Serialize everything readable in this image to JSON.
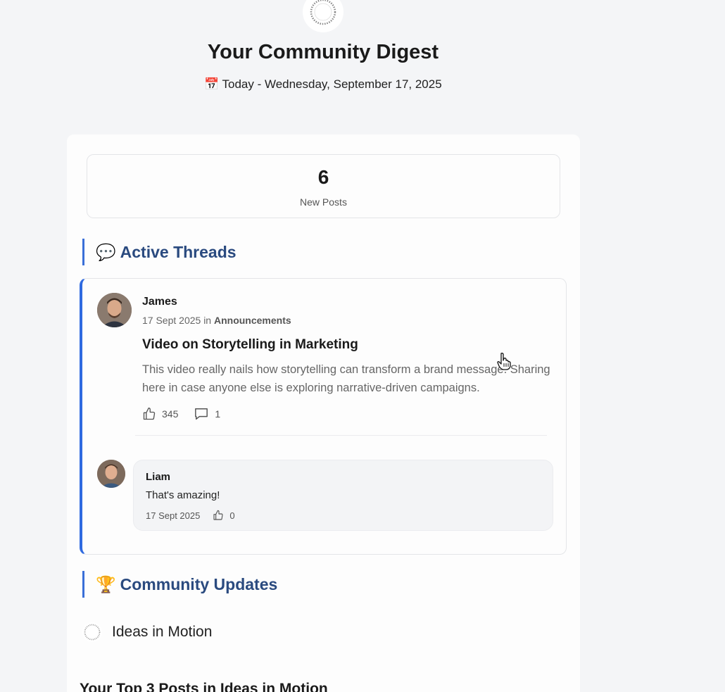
{
  "header": {
    "logo_icon": "circular-text-logo",
    "title": "Your Community Digest",
    "date_icon": "calendar-icon",
    "date_text": "Today - Wednesday, September 17, 2025"
  },
  "stats": {
    "count": "6",
    "label": "New Posts"
  },
  "sections": {
    "active_threads": {
      "emoji": "💬",
      "title": "Active Threads"
    },
    "community_updates": {
      "emoji": "🏆",
      "title": "Community Updates"
    }
  },
  "thread": {
    "author": "James",
    "date": "17 Sept 2025",
    "in_text": "in",
    "category": "Announcements",
    "title": "Video on Storytelling in Marketing",
    "body": "This video really nails how storytelling can transform a brand message. Sharing here in case anyone else is exploring narrative-driven campaigns.",
    "likes": "345",
    "comments": "1",
    "reply": {
      "author": "Liam",
      "text": "That's amazing!",
      "date": "17 Sept 2025",
      "likes": "0"
    }
  },
  "community": {
    "name": "Ideas in Motion"
  },
  "top_posts": {
    "title": "Your Top 3 Posts in Ideas in Motion"
  },
  "colors": {
    "accent_blue": "#2f6ae0",
    "heading_blue": "#2a4a7f",
    "background": "#f4f5f7"
  }
}
